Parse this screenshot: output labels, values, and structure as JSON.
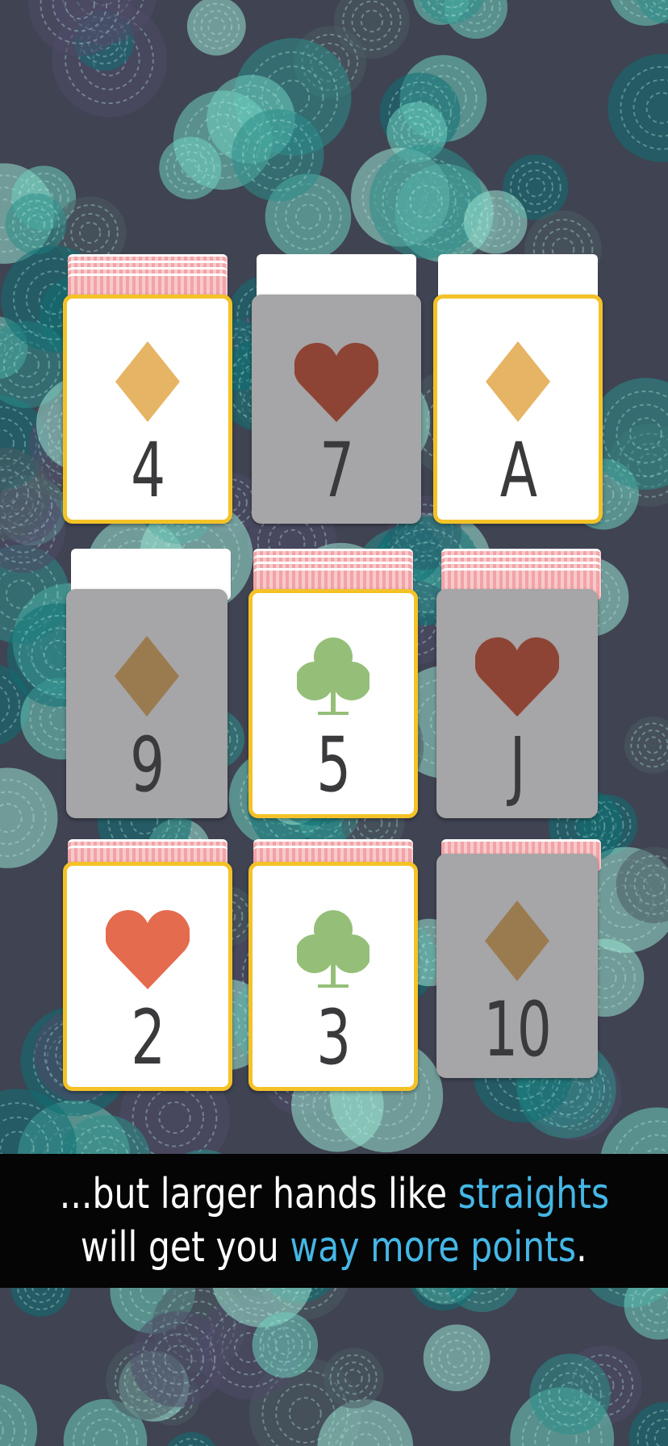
{
  "colors": {
    "background": "#3f4352",
    "selected_border": "#f4c227",
    "card_face": "#ffffff",
    "card_dimmed": "#a6a5a7",
    "caption_bg": "#050505",
    "caption_text": "#ffffff",
    "caption_highlight": "#45b7e6",
    "diamond_gold": "#e6b465",
    "diamond_dim": "#9a7b4f",
    "heart_dim": "#8e4434",
    "heart_red": "#e46b4e",
    "club_green": "#95bf78"
  },
  "cards": [
    {
      "rank": "4",
      "suit": "diamond-icon",
      "state": "selected",
      "suit_color": "#e6b465",
      "back": "red"
    },
    {
      "rank": "7",
      "suit": "heart-icon",
      "state": "dimmed",
      "suit_color": "#8e4434",
      "back": "white"
    },
    {
      "rank": "A",
      "suit": "diamond-icon",
      "state": "selected",
      "suit_color": "#e6b465",
      "back": "white"
    },
    {
      "rank": "9",
      "suit": "diamond-icon",
      "state": "dimmed",
      "suit_color": "#9a7b4f",
      "back": "white"
    },
    {
      "rank": "5",
      "suit": "club-icon",
      "state": "selected",
      "suit_color": "#95bf78",
      "back": "red"
    },
    {
      "rank": "J",
      "suit": "heart-icon",
      "state": "dimmed",
      "suit_color": "#8e4434",
      "back": "red"
    },
    {
      "rank": "2",
      "suit": "heart-icon",
      "state": "selected",
      "suit_color": "#e46b4e",
      "back": "red"
    },
    {
      "rank": "3",
      "suit": "club-icon",
      "state": "selected",
      "suit_color": "#95bf78",
      "back": "red"
    },
    {
      "rank": "10",
      "suit": "diamond-icon",
      "state": "dimmed",
      "suit_color": "#9a7b4f",
      "back": "red"
    }
  ],
  "caption": {
    "line1_prefix": "...but larger hands like ",
    "line1_highlight": "straights",
    "line2_prefix": "will get you ",
    "line2_highlight": "way more points",
    "line2_suffix": "."
  }
}
